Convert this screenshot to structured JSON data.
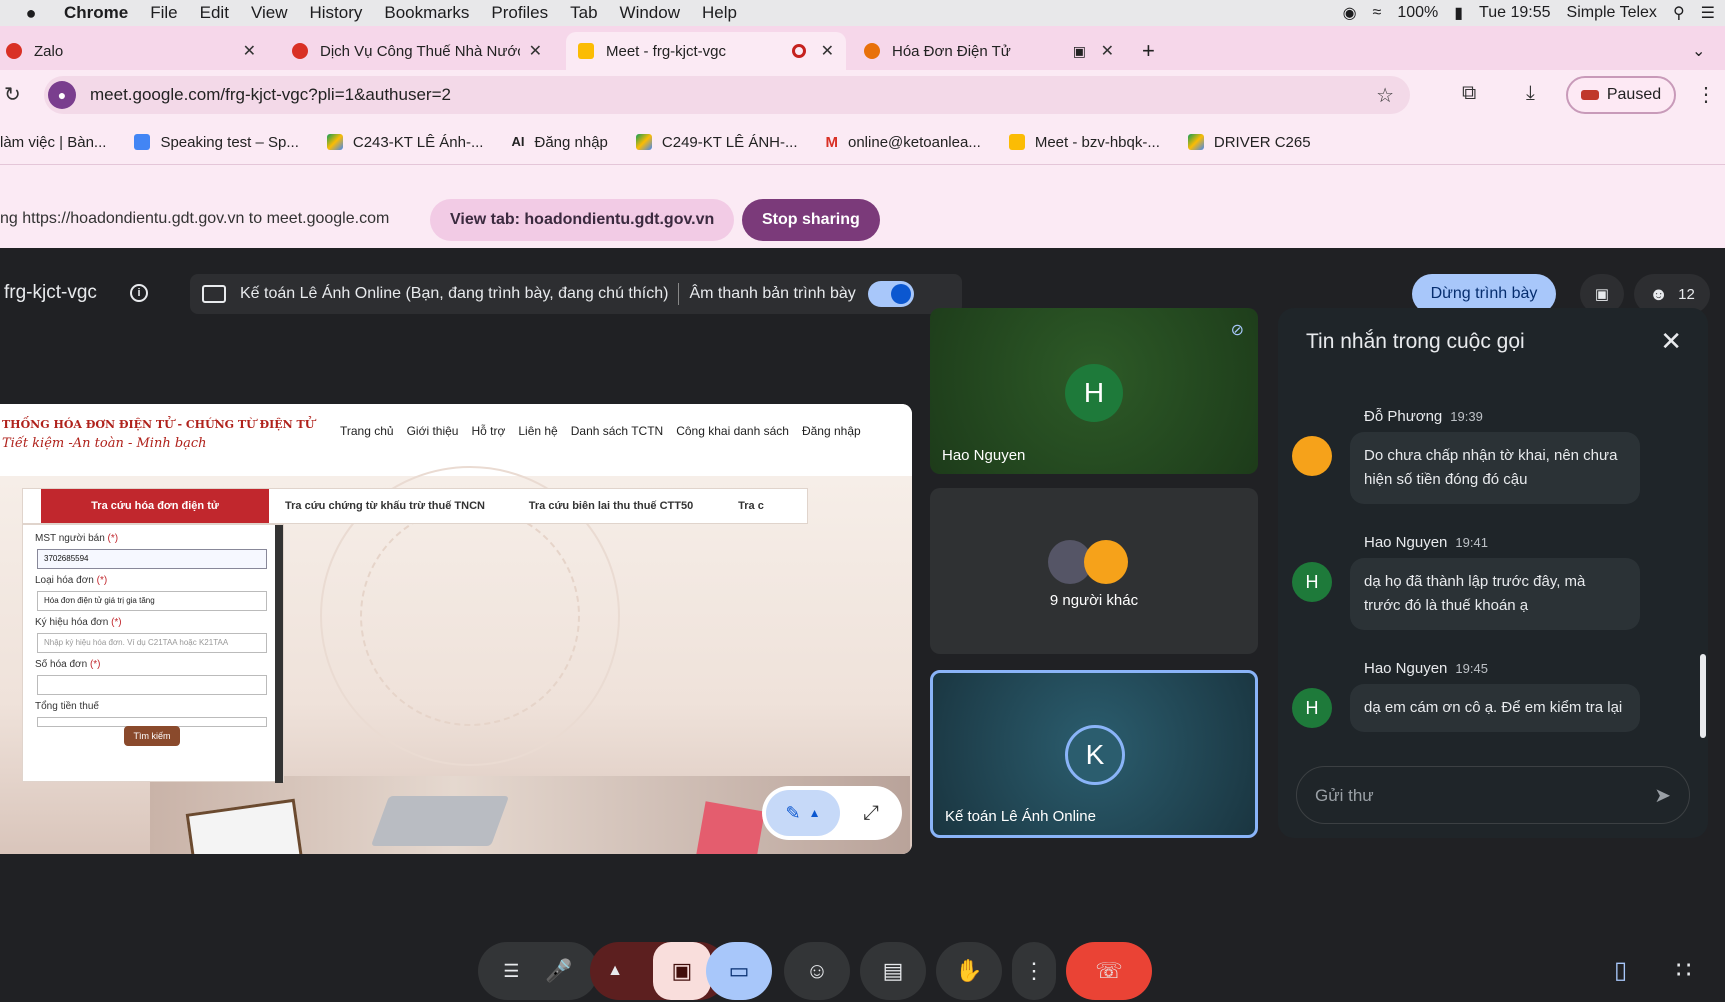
{
  "mac_menubar": {
    "apple": "",
    "app": "Chrome",
    "items": [
      "File",
      "Edit",
      "View",
      "History",
      "Bookmarks",
      "Profiles",
      "Tab",
      "Window",
      "Help"
    ],
    "battery": "100%",
    "clock": "Tue 19:55",
    "telex": "Simple Telex"
  },
  "tabs": [
    {
      "title": "Zalo",
      "color": "#d93025"
    },
    {
      "title": "Dịch Vụ Công Thuế Nhà Nước",
      "color": "#d93025"
    },
    {
      "title": "Meet - frg-kjct-vgc",
      "color": "#fbbc04"
    },
    {
      "title": "Hóa Đơn Điện Tử",
      "color": "#e8710a"
    }
  ],
  "toolbar": {
    "url": "meet.google.com/frg-kjct-vgc?pli=1&authuser=2",
    "paused_label": "Paused"
  },
  "bookmarks": [
    "làm việc | Bàn...",
    "Speaking test – Sp...",
    "C243-KT LÊ Ánh-...",
    "Đăng nhập",
    "C249-KT LÊ ÁNH-...",
    "online@ketoanlea...",
    "Meet - bzv-hbqk-...",
    "DRIVER C265"
  ],
  "share_bar": {
    "text": "ng https://hoadondientu.gdt.gov.vn to meet.google.com",
    "view_tab": "View tab: hoadondientu.gdt.gov.vn",
    "stop_sharing": "Stop sharing"
  },
  "meet": {
    "code": "frg-kjct-vgc",
    "presenting_text": "Kế toán Lê Ánh Online (Bạn, đang trình bày, đang chú thích)",
    "audio_label": "Âm thanh bản trình bày",
    "stop_presenting": "Dừng trình bày",
    "participants_count": "12"
  },
  "shared_site": {
    "title": "THỐNG HÓA ĐƠN ĐIỆN TỬ - CHỨNG TỪ ĐIỆN TỬ",
    "slogan": "Tiết kiệm -An toàn - Minh bạch",
    "nav": [
      "Trang chủ",
      "Giới thiệu",
      "Hỗ trợ",
      "Liên hệ",
      "Danh sách TCTN",
      "Công khai danh sách",
      "Đăng nhập"
    ],
    "tabs": [
      "Tra cứu hóa đơn điện tử",
      "Tra cứu chứng từ khấu trừ thuế TNCN",
      "Tra cứu biên lai thu thuế CTT50",
      "Tra c"
    ],
    "form": {
      "mst_label": "MST người bán",
      "mst_value": "3702685594",
      "loai_label": "Loại hóa đơn",
      "loai_value": "Hóa đơn điện tử giá trị gia tăng",
      "kyhieu_label": "Ký hiệu hóa đơn",
      "kyhieu_placeholder": "Nhập ký hiệu hóa đơn. Ví dụ C21TAA hoặc K21TAA",
      "so_label": "Số hóa đơn",
      "tong_label": "Tổng tiền thuế",
      "required": "(*)",
      "search_btn": "Tìm kiếm"
    }
  },
  "tiles": [
    {
      "name": "Hao Nguyen",
      "initial": "H"
    },
    {
      "name": "9 người khác"
    },
    {
      "name": "Kế toán Lê Ánh Online",
      "initial": "K"
    }
  ],
  "chat": {
    "title": "Tin nhắn trong cuộc gọi",
    "messages": [
      {
        "sender": "Đỗ Phương",
        "time": "19:39",
        "text": "Do chưa chấp nhận tờ khai, nên chưa hiện số tiền đóng đó cậu"
      },
      {
        "sender": "Hao Nguyen",
        "time": "19:41",
        "text": "dạ họ đã thành lập trước đây, mà trước đó là thuế khoán ạ",
        "initial": "H"
      },
      {
        "sender": "Hao Nguyen",
        "time": "19:45",
        "text": "dạ em cám ơn cô ạ. Để em kiểm tra lại",
        "initial": "H"
      }
    ],
    "input_placeholder": "Gửi thư"
  }
}
